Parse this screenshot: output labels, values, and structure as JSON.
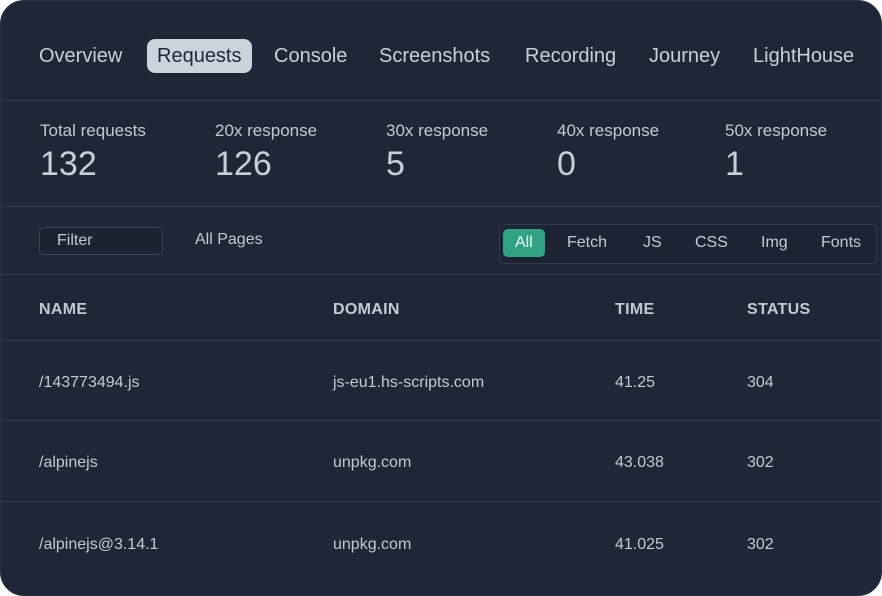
{
  "tabs": [
    {
      "label": "Overview",
      "active": false
    },
    {
      "label": "Requests",
      "active": true
    },
    {
      "label": "Console",
      "active": false
    },
    {
      "label": "Screenshots",
      "active": false
    },
    {
      "label": "Recording",
      "active": false
    },
    {
      "label": "Journey",
      "active": false
    },
    {
      "label": "LightHouse",
      "active": false
    }
  ],
  "stats": [
    {
      "label": "Total requests",
      "value": "132"
    },
    {
      "label": "20x response",
      "value": "126"
    },
    {
      "label": "30x response",
      "value": "5"
    },
    {
      "label": "40x response",
      "value": "0"
    },
    {
      "label": "50x response",
      "value": "1"
    }
  ],
  "filters": {
    "filter_placeholder": "Filter",
    "pages_label": "All Pages",
    "types": [
      {
        "label": "All",
        "active": true
      },
      {
        "label": "Fetch",
        "active": false
      },
      {
        "label": "JS",
        "active": false
      },
      {
        "label": "CSS",
        "active": false
      },
      {
        "label": "Img",
        "active": false
      },
      {
        "label": "Fonts",
        "active": false
      }
    ]
  },
  "table": {
    "columns": [
      "NAME",
      "DOMAIN",
      "TIME",
      "STATUS"
    ],
    "rows": [
      {
        "name": "/143773494.js",
        "domain": "js-eu1.hs-scripts.com",
        "time": "41.25",
        "status": "304"
      },
      {
        "name": "/alpinejs",
        "domain": "unpkg.com",
        "time": "43.038",
        "status": "302"
      },
      {
        "name": "/alpinejs@3.14.1",
        "domain": "unpkg.com",
        "time": "41.025",
        "status": "302"
      }
    ]
  },
  "colors": {
    "panel_bg": "#1e2638",
    "active_tab_bg": "#cdd3dd",
    "accent_green": "#2fa382",
    "divider": "#323b4f"
  }
}
